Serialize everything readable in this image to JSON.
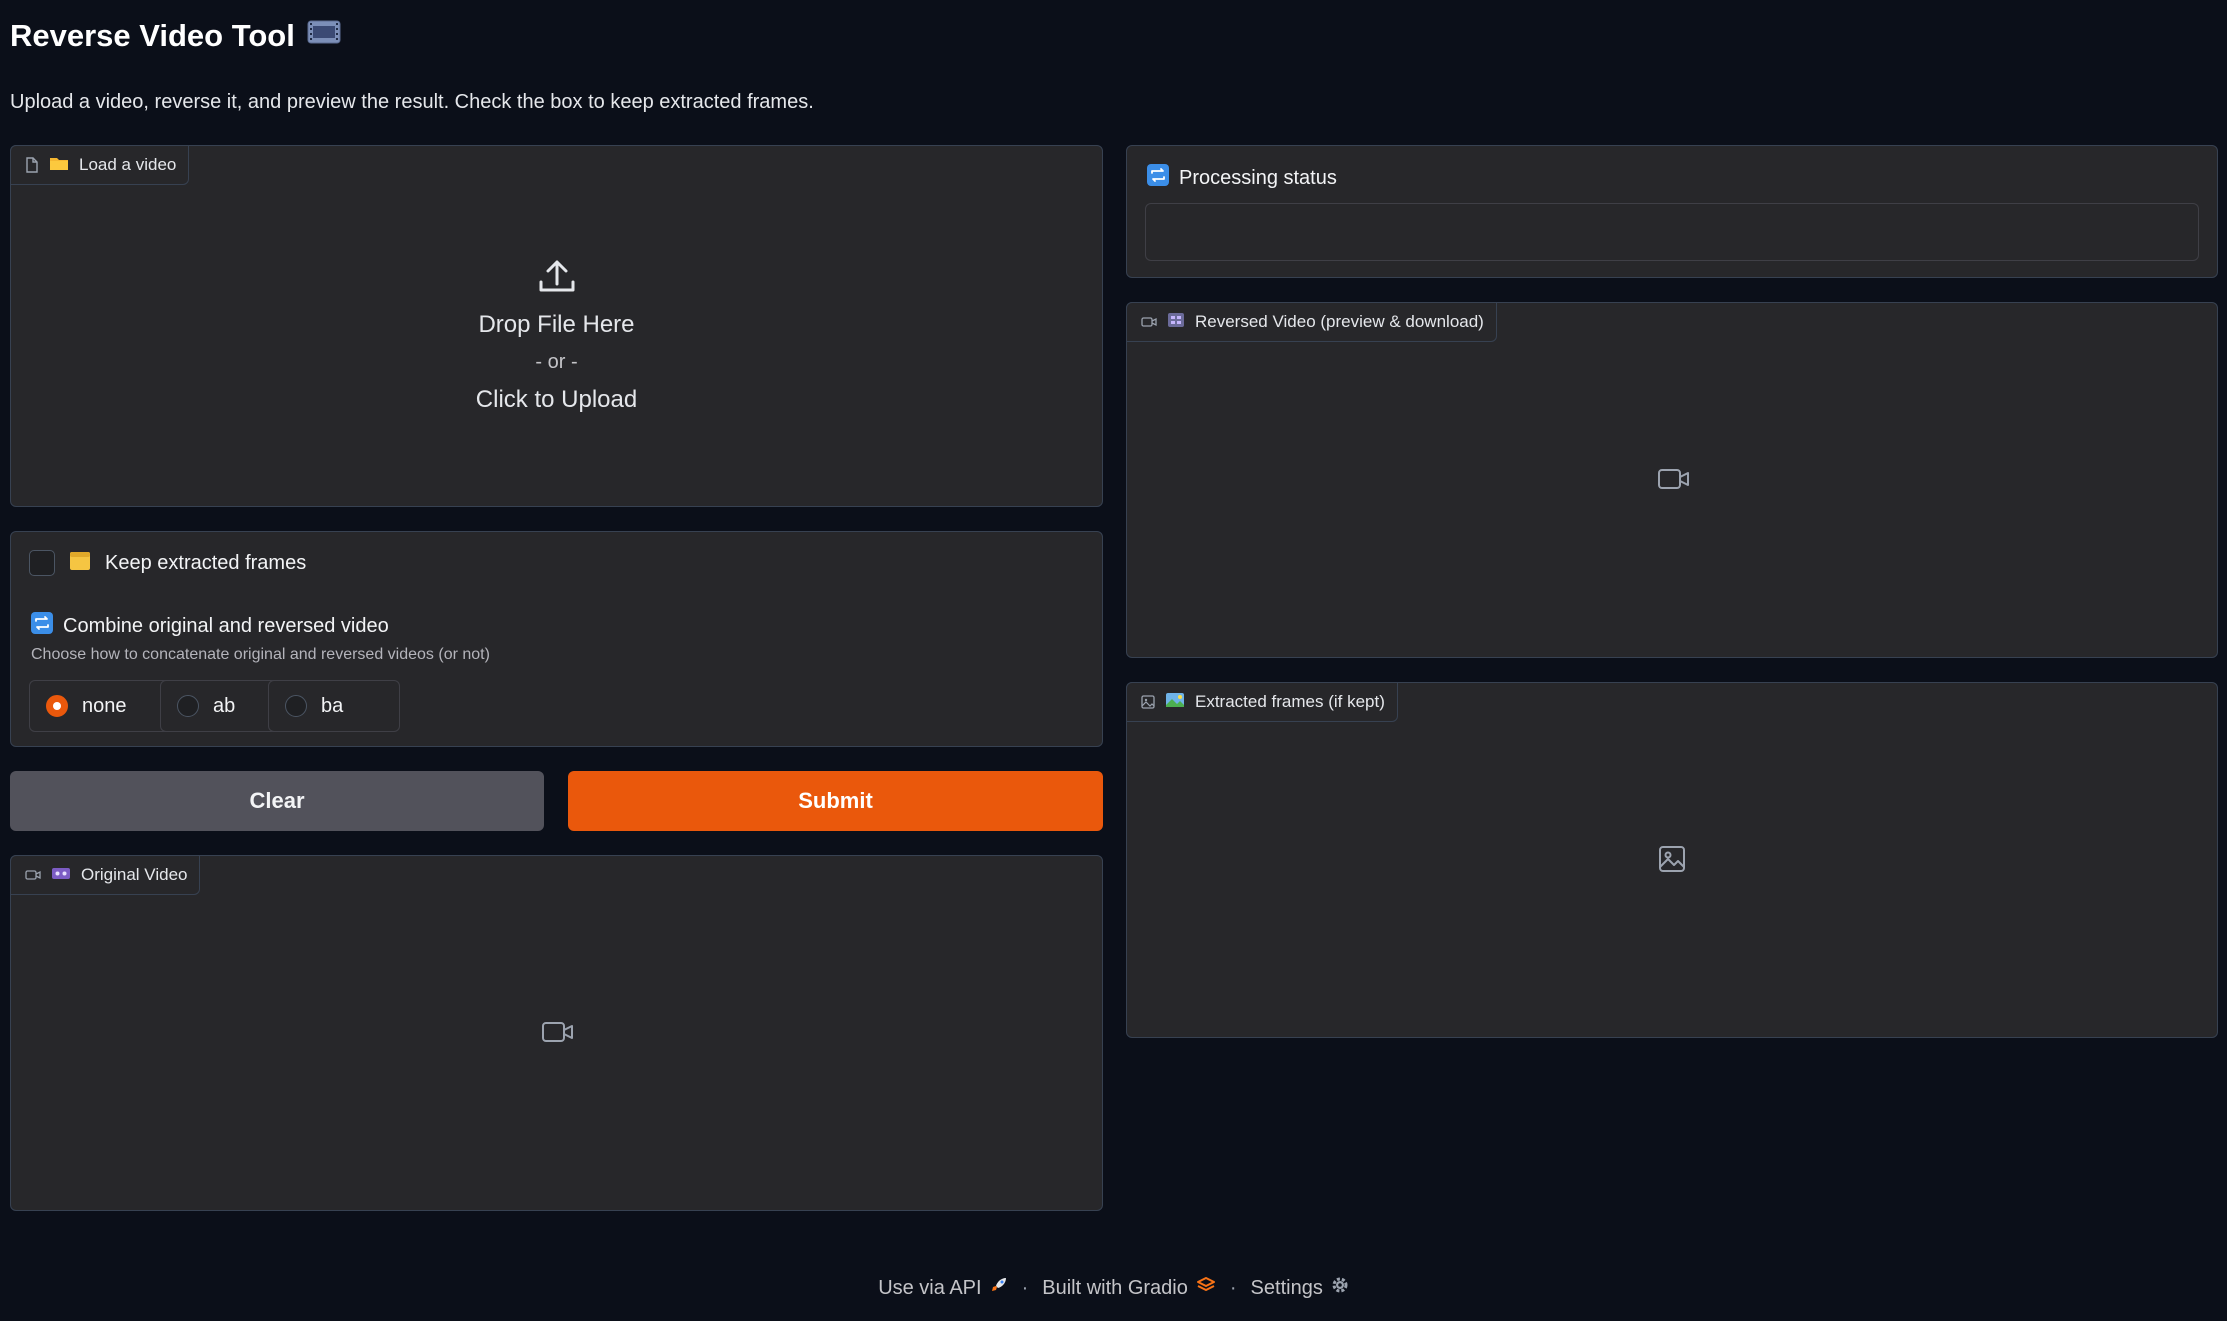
{
  "app": {
    "title": "Reverse Video Tool",
    "subtitle": "Upload a video, reverse it, and preview the result. Check the box to keep extracted frames."
  },
  "upload": {
    "label": "Load a video",
    "drop_text": "Drop File Here",
    "or_text": "- or -",
    "click_text": "Click to Upload"
  },
  "options": {
    "keep_frames_label": "Keep extracted frames",
    "keep_frames_checked": false,
    "combine_label": "Combine original and reversed video",
    "combine_info": "Choose how to concatenate original and reversed videos (or not)",
    "radio_options": [
      "none",
      "ab",
      "ba"
    ],
    "radio_selected": "none"
  },
  "buttons": {
    "clear": "Clear",
    "submit": "Submit"
  },
  "original_video": {
    "label": "Original Video"
  },
  "status": {
    "label": "Processing status",
    "value": ""
  },
  "reversed_video": {
    "label": "Reversed Video (preview & download)"
  },
  "frames": {
    "label": "Extracted frames (if kept)"
  },
  "footer": {
    "api": "Use via API",
    "built": "Built with Gradio",
    "settings": "Settings",
    "separator": "·"
  },
  "colors": {
    "background": "#0b0f19",
    "panel": "#27272a",
    "accent": "#ea580c",
    "secondary_button": "#52525b"
  }
}
